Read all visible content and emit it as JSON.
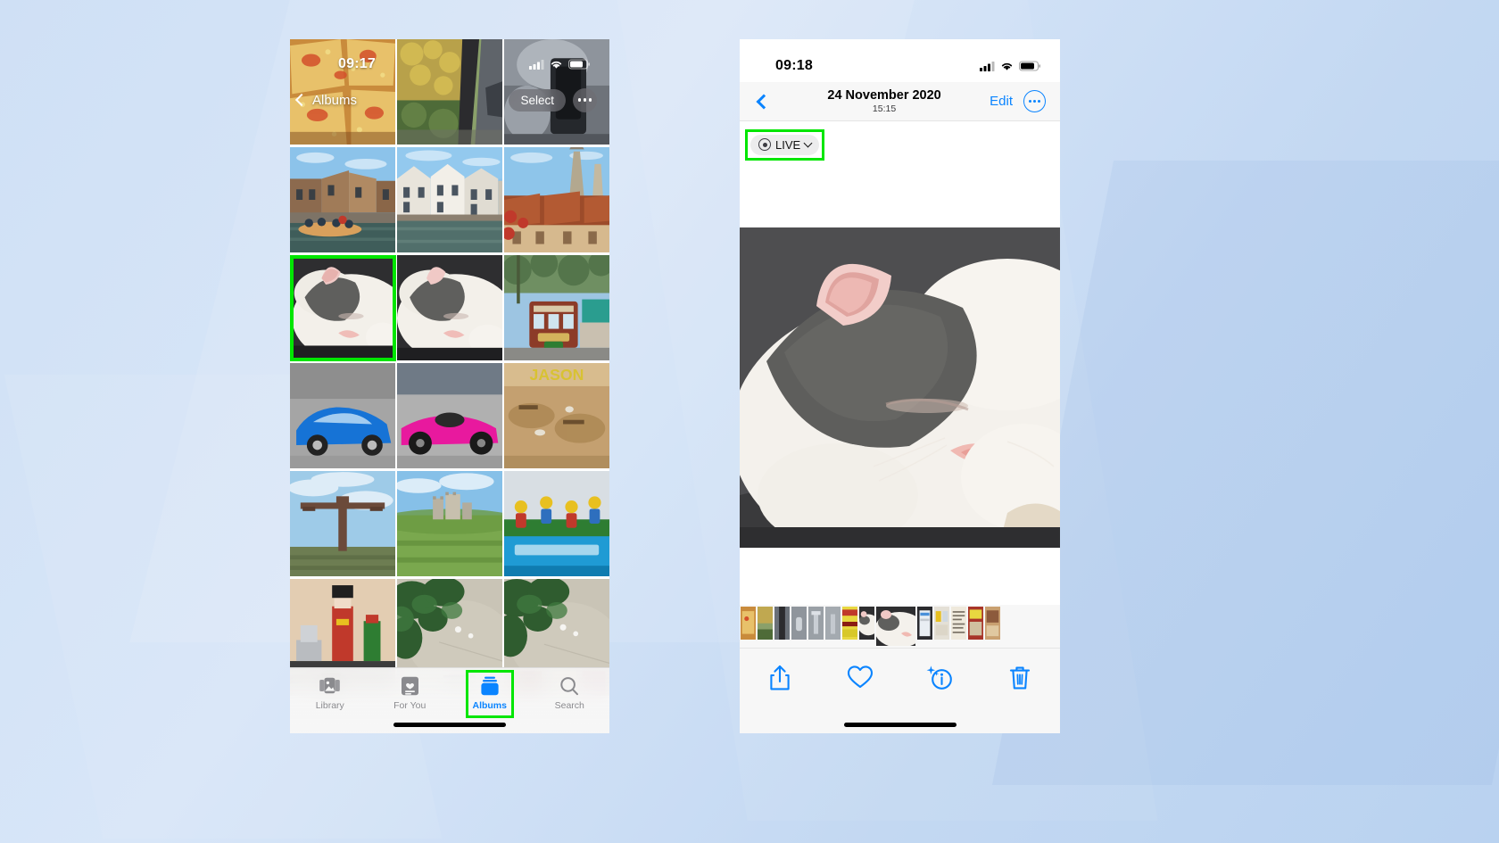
{
  "page": {
    "title": "iPhone Photos app — Live Photo in album grid and single photo view",
    "background_color": "#cfe0f5",
    "highlight_color": "#00e600",
    "accent_color": "#0a84ff"
  },
  "left_phone": {
    "status_bar": {
      "time": "09:17",
      "icons": [
        "cellular-signal-icon",
        "wifi-icon",
        "battery-icon"
      ]
    },
    "nav_bar": {
      "back_label": "Albums",
      "back_icon": "chevron-left-icon",
      "select_label": "Select",
      "more_icon": "more-ellipsis-icon"
    },
    "grid": {
      "selected_index": 6,
      "selection_outline_color": "#00e600",
      "photos": [
        {
          "name": "pizza-slices",
          "alt": "Pizza with corn and tomato slices"
        },
        {
          "name": "autumn-tree-from-car",
          "alt": "Autumn tree seen through a car window"
        },
        {
          "name": "car-dashboard",
          "alt": "Car interior dashboard"
        },
        {
          "name": "bruges-canal-boat",
          "alt": "Canal with tour boat and brick houses"
        },
        {
          "name": "bruges-canal-houses",
          "alt": "Canal with white gabled houses"
        },
        {
          "name": "town-rooftops-church",
          "alt": "Red rooftops with church spire"
        },
        {
          "name": "sleeping-cat-1",
          "alt": "White and grey cat sleeping"
        },
        {
          "name": "sleeping-cat-2",
          "alt": "White and grey cat sleeping, second frame"
        },
        {
          "name": "laxey-tram",
          "alt": "Vintage tram at Laxey station"
        },
        {
          "name": "blue-lamborghini",
          "alt": "Blue sports car"
        },
        {
          "name": "pink-race-car",
          "alt": "Pink BAC race car"
        },
        {
          "name": "archaeology-dig",
          "alt": "Archaeological dig site model"
        },
        {
          "name": "angel-of-the-north",
          "alt": "Angel of the North sculpture"
        },
        {
          "name": "castle-ruins-field",
          "alt": "Castle ruins on a green field"
        },
        {
          "name": "lego-minifigures",
          "alt": "Lego minifigures scene"
        },
        {
          "name": "nutcracker-figure",
          "alt": "Nutcracker soldier ornament"
        },
        {
          "name": "garden-path-1",
          "alt": "Garden path with shrubs"
        },
        {
          "name": "garden-path-2",
          "alt": "Garden path with shrubs, second frame"
        }
      ]
    },
    "tab_bar": {
      "active_tab": "Albums",
      "highlight_color": "#00e600",
      "tabs": [
        {
          "label": "Library",
          "icon": "photo-stack-icon",
          "active": false
        },
        {
          "label": "For You",
          "icon": "for-you-card-icon",
          "active": false
        },
        {
          "label": "Albums",
          "icon": "albums-icon",
          "active": true
        },
        {
          "label": "Search",
          "icon": "search-icon",
          "active": false
        }
      ]
    }
  },
  "right_phone": {
    "status_bar": {
      "time": "09:18",
      "icons": [
        "cellular-signal-icon",
        "wifi-icon",
        "battery-icon"
      ]
    },
    "nav_bar": {
      "back_icon": "chevron-left-icon",
      "title": "24 November 2020",
      "subtitle": "15:15",
      "edit_label": "Edit",
      "more_icon": "more-ellipsis-circle-icon"
    },
    "live_badge": {
      "label": "LIVE",
      "icon": "live-photo-icon",
      "chevron": "chevron-down-icon",
      "highlighted": true,
      "highlight_color": "#00e600"
    },
    "hero_photo": {
      "name": "sleeping-cat-live-photo",
      "alt": "Close-up of a white and grey cat sleeping on a dark blanket"
    },
    "filmstrip": {
      "thumbs": [
        "pizza-slices",
        "autumn-tree",
        "car-window",
        "door-handle",
        "tap-1",
        "tap-2",
        "newspaper-red",
        "cat-thumb-1",
        "cat-thumb-selected",
        "phone-screen",
        "poster-wall",
        "newspaper-text",
        "magazine-cover",
        "book-page"
      ],
      "selected": "cat-thumb-selected"
    },
    "toolbar": {
      "items": [
        {
          "label": "Share",
          "icon": "share-icon"
        },
        {
          "label": "Favorite",
          "icon": "heart-icon"
        },
        {
          "label": "Info",
          "icon": "info-sparkle-icon"
        },
        {
          "label": "Delete",
          "icon": "trash-icon"
        }
      ]
    }
  }
}
